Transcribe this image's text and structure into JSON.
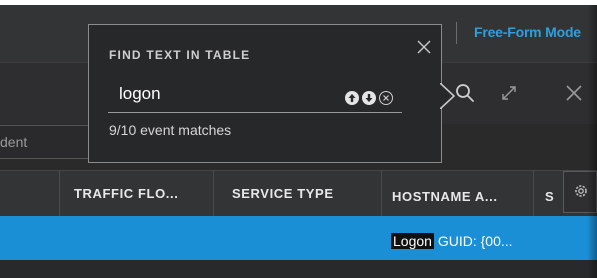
{
  "header": {
    "mode_link": "Free-Form Mode"
  },
  "filter": {
    "partial_text": "dent"
  },
  "table": {
    "columns": [
      "TRAFFIC FLO...",
      "SERVICE TYPE",
      "HOSTNAME A...",
      "S"
    ],
    "selected_row": {
      "hostname_highlight": "Logon",
      "hostname_rest": " GUID: {00..."
    },
    "row_color": "#1b8fd6"
  },
  "find_panel": {
    "title": "FIND TEXT IN TABLE",
    "query": "logon",
    "match_status": "9/10 event matches",
    "icons": [
      "previous-match-icon",
      "next-match-icon",
      "clear-search-icon",
      "close-icon"
    ]
  },
  "toolbar": {
    "icons": [
      "search-icon",
      "expand-icon",
      "close-icon"
    ]
  },
  "colors": {
    "accent": "#2d9fe0",
    "panel_bg": "#27282a",
    "header_bg": "#333436"
  }
}
